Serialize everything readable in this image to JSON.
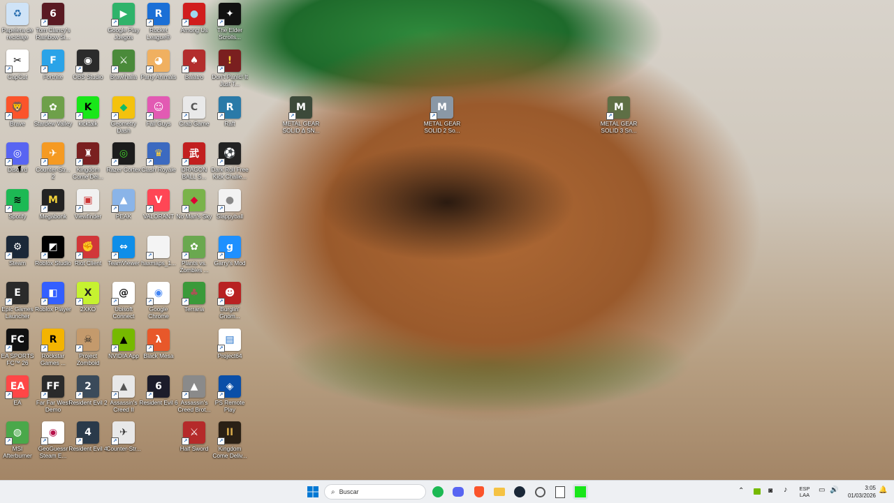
{
  "desktop": {
    "icons": [
      {
        "label": "Papelera de reciclaje",
        "glyph": "♻",
        "bg": "#cfe3f7",
        "fg": "#2a6fb0"
      },
      {
        "label": "Tom Clancy's Rainbow Si...",
        "glyph": "6",
        "bg": "#5a1a22",
        "fg": "#fff"
      },
      {
        "label": "Google Play Juegos",
        "glyph": "▶",
        "bg": "#2fb36a",
        "fg": "#fff"
      },
      {
        "label": "Rocket League®",
        "glyph": "R",
        "bg": "#1b6fd6",
        "fg": "#fff"
      },
      {
        "label": "Among Us",
        "glyph": "●",
        "bg": "#d11d1d",
        "fg": "#9fd8ef"
      },
      {
        "label": "The Elder Scrolls...",
        "glyph": "✦",
        "bg": "#111",
        "fg": "#fff"
      },
      {
        "label": "CapCut",
        "glyph": "✂",
        "bg": "#fff",
        "fg": "#000"
      },
      {
        "label": "Fortnite",
        "glyph": "F",
        "bg": "#2aa3e8",
        "fg": "#fff"
      },
      {
        "label": "OBS Studio",
        "glyph": "◉",
        "bg": "#2b2b2b",
        "fg": "#fff"
      },
      {
        "label": "Brawlhalla",
        "glyph": "⚔",
        "bg": "#4a8a3a",
        "fg": "#fff"
      },
      {
        "label": "Party Animals",
        "glyph": "◕",
        "bg": "#f0b060",
        "fg": "#fff"
      },
      {
        "label": "Balatro",
        "glyph": "♠",
        "bg": "#b32d2d",
        "fg": "#fff"
      },
      {
        "label": "Don't Panic! It Just T...",
        "glyph": "!",
        "bg": "#7a1f1f",
        "fg": "#f7d23a"
      },
      {
        "label": "Brave",
        "glyph": "🦁",
        "bg": "#fb542b",
        "fg": "#fff"
      },
      {
        "label": "Stardew Valley",
        "glyph": "✿",
        "bg": "#6ea04a",
        "fg": "#fff"
      },
      {
        "label": "kicktalk",
        "glyph": "K",
        "bg": "#19e619",
        "fg": "#000"
      },
      {
        "label": "Geometry Dash",
        "glyph": "◆",
        "bg": "#f4c20d",
        "fg": "#1b6"
      },
      {
        "label": "Fall Guys",
        "glyph": "☺",
        "bg": "#e25ab3",
        "fg": "#fff"
      },
      {
        "label": "Crab Game",
        "glyph": "C",
        "bg": "#e9e9e9",
        "fg": "#555"
      },
      {
        "label": "Raft",
        "glyph": "R",
        "bg": "#2a7aa8",
        "fg": "#fff"
      },
      {
        "label": "METAL GEAR SOLID Δ SN...",
        "glyph": "M",
        "bg": "#3d4a3a",
        "fg": "#fff"
      },
      {
        "label": "METAL GEAR SOLID 2 So...",
        "glyph": "M",
        "bg": "#8a98a6",
        "fg": "#fff"
      },
      {
        "label": "METAL GEAR SOLID 3 Sn...",
        "glyph": "M",
        "bg": "#5e6f45",
        "fg": "#fff"
      },
      {
        "label": "Discord",
        "glyph": "◎",
        "bg": "#5865f2",
        "fg": "#fff"
      },
      {
        "label": "Counter-Str... 2",
        "glyph": "✈",
        "bg": "#f59a22",
        "fg": "#fff"
      },
      {
        "label": "Kingdom Come Del...",
        "glyph": "♜",
        "bg": "#7a2020",
        "fg": "#fff"
      },
      {
        "label": "Razer Cortex",
        "glyph": "◎",
        "bg": "#1c1c1c",
        "fg": "#44d62c"
      },
      {
        "label": "Clash Royale",
        "glyph": "♛",
        "bg": "#3c6ac0",
        "fg": "#ffd23a"
      },
      {
        "label": "DRAGON BALL S...",
        "glyph": "武",
        "bg": "#c21f1f",
        "fg": "#fff"
      },
      {
        "label": "Dark Roll Free Kick Challe...",
        "glyph": "⚽",
        "bg": "#222",
        "fg": "#fff"
      },
      {
        "label": "Spotify",
        "glyph": "≋",
        "bg": "#1db954",
        "fg": "#000"
      },
      {
        "label": "Megabonk",
        "glyph": "M",
        "bg": "#222",
        "fg": "#f4d33a"
      },
      {
        "label": "Viewfinder",
        "glyph": "▣",
        "bg": "#f1f1f1",
        "fg": "#c33"
      },
      {
        "label": "PEAK",
        "glyph": "▲",
        "bg": "#8ab4e8",
        "fg": "#fff"
      },
      {
        "label": "VALORANT",
        "glyph": "V",
        "bg": "#ff4655",
        "fg": "#fff"
      },
      {
        "label": "No Man's Sky",
        "glyph": "◆",
        "bg": "#7ab34a",
        "fg": "#d03"
      },
      {
        "label": "Slappyball",
        "glyph": "●",
        "bg": "#f2f2f2",
        "fg": "#888"
      },
      {
        "label": "Steam",
        "glyph": "⚙",
        "bg": "#1b2838",
        "fg": "#fff"
      },
      {
        "label": "Roblox Studio",
        "glyph": "◩",
        "bg": "#000",
        "fg": "#fff"
      },
      {
        "label": "Riot Client",
        "glyph": "✊",
        "bg": "#d13639",
        "fg": "#fff"
      },
      {
        "label": "TeamViewer",
        "glyph": "⇔",
        "bg": "#0e8ee9",
        "fg": "#fff"
      },
      {
        "label": "haxmaps_1...",
        "glyph": "",
        "bg": "#f4f4f4",
        "fg": "#888"
      },
      {
        "label": "Plants vs. Zombies ...",
        "glyph": "✿",
        "bg": "#6aa84f",
        "fg": "#fff"
      },
      {
        "label": "Garry's Mod",
        "glyph": "g",
        "bg": "#1e90ff",
        "fg": "#fff"
      },
      {
        "label": "Epic Games Launcher",
        "glyph": "E",
        "bg": "#2a2a2a",
        "fg": "#fff"
      },
      {
        "label": "Roblox Player",
        "glyph": "◧",
        "bg": "#335fff",
        "fg": "#fff"
      },
      {
        "label": "2XKO",
        "glyph": "X",
        "bg": "#c6f230",
        "fg": "#222"
      },
      {
        "label": "Ubisoft Connect",
        "glyph": "@",
        "bg": "#fff",
        "fg": "#111"
      },
      {
        "label": "Google Chrome",
        "glyph": "◉",
        "bg": "#fff",
        "fg": "#4285f4"
      },
      {
        "label": "Terraria",
        "glyph": "♣",
        "bg": "#3a9a3a",
        "fg": "#a55"
      },
      {
        "label": "Burglin' Gnom...",
        "glyph": "☻",
        "bg": "#b82222",
        "fg": "#fff"
      },
      {
        "label": "EA SPORTS FC™ 26",
        "glyph": "FC",
        "bg": "#111",
        "fg": "#fff"
      },
      {
        "label": "Rockstar Games ...",
        "glyph": "R",
        "bg": "#f4b400",
        "fg": "#000"
      },
      {
        "label": "Project Zomboid",
        "glyph": "☠",
        "bg": "#c49a6c",
        "fg": "#222"
      },
      {
        "label": "NVIDIA App",
        "glyph": "▲",
        "bg": "#76b900",
        "fg": "#000"
      },
      {
        "label": "Black Mesa",
        "glyph": "λ",
        "bg": "#e8582a",
        "fg": "#fff"
      },
      {
        "label": "Project64",
        "glyph": "▤",
        "bg": "#fff",
        "fg": "#1e6ec8"
      },
      {
        "label": "EA",
        "glyph": "EA",
        "bg": "#ff4747",
        "fg": "#fff"
      },
      {
        "label": "Far Far West Demo",
        "glyph": "FF",
        "bg": "#2a2a2a",
        "fg": "#fff"
      },
      {
        "label": "Resident Evil 2",
        "glyph": "2",
        "bg": "#3a4a5a",
        "fg": "#fff"
      },
      {
        "label": "Assassin's Creed II",
        "glyph": "▲",
        "bg": "#e8e8e8",
        "fg": "#555"
      },
      {
        "label": "Resident Evil 6",
        "glyph": "6",
        "bg": "#1c1c2a",
        "fg": "#fff"
      },
      {
        "label": "Assassin's Creed Brot...",
        "glyph": "▲",
        "bg": "#8a8a8a",
        "fg": "#fff"
      },
      {
        "label": "PS Remote Play",
        "glyph": "◈",
        "bg": "#0a4fa8",
        "fg": "#fff"
      },
      {
        "label": "MSI Afterburner",
        "glyph": "◍",
        "bg": "#4aa84a",
        "fg": "#fff"
      },
      {
        "label": "GeoGuessr Steam E...",
        "glyph": "◉",
        "bg": "#fff",
        "fg": "#b7114a"
      },
      {
        "label": "Resident Evil 4",
        "glyph": "4",
        "bg": "#2a3a4a",
        "fg": "#fff"
      },
      {
        "label": "Counter-Str...",
        "glyph": "✈",
        "bg": "#e8e8e8",
        "fg": "#333"
      },
      {
        "label": "Half Sword",
        "glyph": "⚔",
        "bg": "#b52a2a",
        "fg": "#fff"
      },
      {
        "label": "Kingdom Come Deliv...",
        "glyph": "II",
        "bg": "#2a2015",
        "fg": "#d4a84a"
      }
    ]
  },
  "taskbar": {
    "search_placeholder": "Buscar",
    "lang_top": "ESP",
    "lang_bottom": "LAA",
    "time": "3:05",
    "date": "01/03/2026"
  }
}
